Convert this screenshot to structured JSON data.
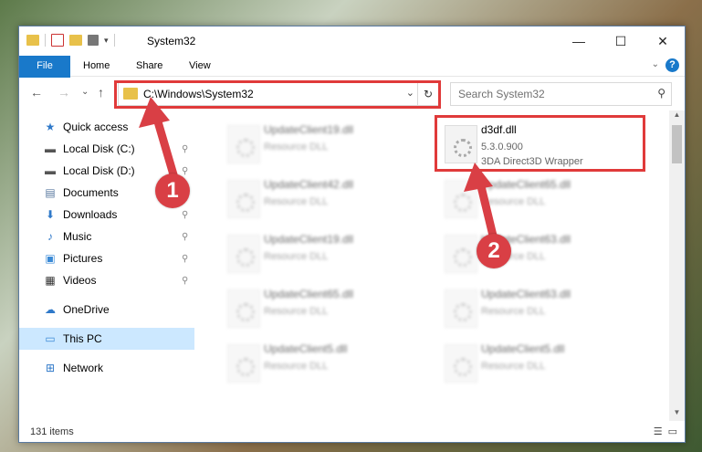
{
  "window": {
    "title": "System32",
    "minimize": "—",
    "maximize": "☐",
    "close": "✕"
  },
  "ribbon": {
    "tabs": [
      "File",
      "Home",
      "Share",
      "View"
    ],
    "collapse": "⌄",
    "help": "?"
  },
  "nav": {
    "back": "←",
    "forward": "→",
    "recent": "⌄",
    "up": "↑",
    "address": "C:\\Windows\\System32",
    "dropdown": "⌄",
    "refresh": "↻",
    "search_placeholder": "Search System32",
    "search_icon": "⚲"
  },
  "sidebar": [
    {
      "label": "Quick access",
      "icon": "star-icon",
      "glyph": "★",
      "color": "#2f79c9",
      "pinned": false
    },
    {
      "label": "Local Disk (C:)",
      "icon": "drive-icon",
      "glyph": "▬",
      "color": "#555",
      "pinned": true
    },
    {
      "label": "Local Disk (D:)",
      "icon": "drive-icon",
      "glyph": "▬",
      "color": "#555",
      "pinned": true
    },
    {
      "label": "Documents",
      "icon": "documents-icon",
      "glyph": "▤",
      "color": "#5a7aa0",
      "pinned": true
    },
    {
      "label": "Downloads",
      "icon": "download-icon",
      "glyph": "⬇",
      "color": "#2f79c9",
      "pinned": true
    },
    {
      "label": "Music",
      "icon": "music-icon",
      "glyph": "♪",
      "color": "#2f79c9",
      "pinned": true
    },
    {
      "label": "Pictures",
      "icon": "pictures-icon",
      "glyph": "▣",
      "color": "#3b8ad6",
      "pinned": true
    },
    {
      "label": "Videos",
      "icon": "videos-icon",
      "glyph": "▦",
      "color": "#333",
      "pinned": true
    },
    {
      "label": "OneDrive",
      "icon": "cloud-icon",
      "glyph": "☁",
      "color": "#2f79c9",
      "pinned": false
    },
    {
      "label": "This PC",
      "icon": "computer-icon",
      "glyph": "▭",
      "color": "#3b8ad6",
      "pinned": false,
      "selected": true
    },
    {
      "label": "Network",
      "icon": "network-icon",
      "glyph": "⊞",
      "color": "#2f79c9",
      "pinned": false
    }
  ],
  "pin_glyph": "⚲",
  "files_left": [
    {
      "name": "UpdateClient19.dll",
      "type": "Resource DLL"
    },
    {
      "name": "UpdateClient42.dll",
      "type": "Resource DLL"
    },
    {
      "name": "UpdateClient19.dll",
      "type": "Resource DLL"
    },
    {
      "name": "UpdateClient65.dll",
      "type": "Resource DLL"
    },
    {
      "name": "UpdateClient5.dll",
      "type": "Resource DLL"
    }
  ],
  "files_right": [
    {
      "name": "d3df.dll",
      "version": "5.3.0.900",
      "type": "3DA Direct3D Wrapper"
    },
    {
      "name": "UpdateClient65.dll",
      "type": "Resource DLL"
    },
    {
      "name": "UpdateClient63.dll",
      "type": "Resource DLL"
    },
    {
      "name": "UpdateClient63.dll",
      "type": "Resource DLL"
    },
    {
      "name": "UpdateClient5.dll",
      "type": "Resource DLL"
    }
  ],
  "status": {
    "count": "131 items",
    "view_details": "☰",
    "view_tiles": "▭"
  },
  "markers": [
    "1",
    "2"
  ],
  "colors": {
    "accent": "#1979ca",
    "highlight_red": "#e03a3a",
    "marker": "#d93f45"
  }
}
